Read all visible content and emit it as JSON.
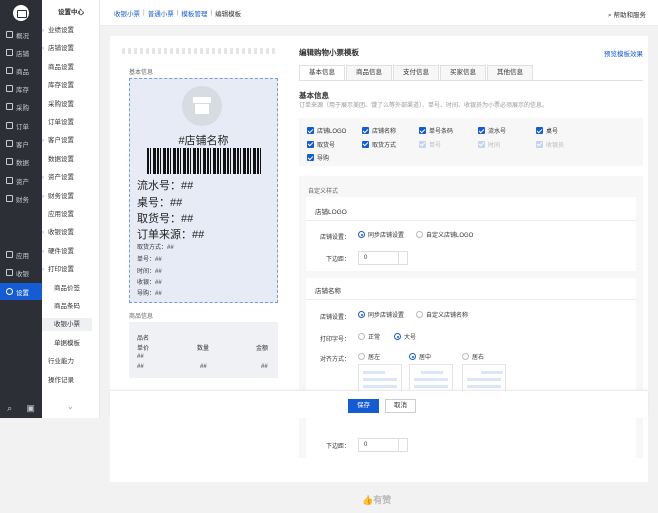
{
  "nav": {
    "items": [
      {
        "label": "概况",
        "icon": "overview-icon"
      },
      {
        "label": "店铺",
        "icon": "store-icon"
      },
      {
        "label": "商品",
        "icon": "goods-icon"
      },
      {
        "label": "库存",
        "icon": "inventory-icon"
      },
      {
        "label": "采购",
        "icon": "purchase-icon"
      },
      {
        "label": "订单",
        "icon": "order-icon"
      },
      {
        "label": "客户",
        "icon": "customer-icon"
      },
      {
        "label": "数据",
        "icon": "data-icon"
      },
      {
        "label": "资产",
        "icon": "asset-icon"
      },
      {
        "label": "财务",
        "icon": "finance-icon"
      }
    ],
    "bottom_items": [
      {
        "label": "应用",
        "icon": "apps-icon"
      },
      {
        "label": "收银",
        "icon": "cashier-icon"
      },
      {
        "label": "设置",
        "icon": "settings-icon"
      }
    ]
  },
  "subnav": {
    "title": "设置中心",
    "items": [
      {
        "label": "业绩设置",
        "type": "group"
      },
      {
        "label": "店铺设置",
        "type": "group"
      },
      {
        "label": "商品设置",
        "type": "item"
      },
      {
        "label": "库存设置",
        "type": "item"
      },
      {
        "label": "采购设置",
        "type": "item"
      },
      {
        "label": "订单设置",
        "type": "item"
      },
      {
        "label": "客户设置",
        "type": "group"
      },
      {
        "label": "数据设置",
        "type": "item"
      },
      {
        "label": "资产设置",
        "type": "group"
      },
      {
        "label": "财务设置",
        "type": "group"
      },
      {
        "label": "应用设置",
        "type": "item"
      },
      {
        "label": "收银设置",
        "type": "group"
      },
      {
        "label": "硬件设置",
        "type": "group"
      },
      {
        "label": "打印设置",
        "type": "open"
      },
      {
        "label": "商品价签",
        "type": "child"
      },
      {
        "label": "商品条码",
        "type": "child"
      },
      {
        "label": "收银小票",
        "type": "child"
      },
      {
        "label": "单据模板",
        "type": "child"
      },
      {
        "label": "行业能力",
        "type": "item"
      },
      {
        "label": "操作记录",
        "type": "item"
      }
    ],
    "selected": "收银小票"
  },
  "breadcrumb": [
    "收银小票",
    "普通小票",
    "模板管理",
    "编辑模板"
  ],
  "help": "帮助和服务",
  "preview": {
    "basic_label": "基本信息",
    "shop_name": "#店铺名称",
    "big_lines": [
      "流水号：##",
      "桌号：##",
      "取货号：##",
      "订单来源：##"
    ],
    "small_lines": [
      "取货方式：##",
      "单号：##",
      "时间：##",
      "收银：##",
      "导购：##"
    ],
    "goods_label": "商品信息",
    "goods": {
      "name_header": "品名",
      "headers": [
        "单价",
        "数量",
        "金额"
      ],
      "row1": "##",
      "row2": [
        "##",
        "##",
        "##"
      ]
    }
  },
  "editor": {
    "title": "编辑购物小票模板",
    "preview_link": "预览模板效果",
    "tabs": [
      "基本信息",
      "商品信息",
      "支付信息",
      "买家信息",
      "其他信息"
    ],
    "active_tab": "基本信息",
    "basic_heading": "基本信息",
    "basic_desc": "订单来源（用于展示美团、饿了么等外部渠道）、单号、时间、收银员为小票必须展示的信息。",
    "checkboxes": [
      {
        "label": "店铺LOGO",
        "checked": true,
        "disabled": false
      },
      {
        "label": "店铺名称",
        "checked": true,
        "disabled": false
      },
      {
        "label": "单号条码",
        "checked": true,
        "disabled": false
      },
      {
        "label": "流水号",
        "checked": true,
        "disabled": false
      },
      {
        "label": "桌号",
        "checked": true,
        "disabled": false
      },
      {
        "label": "取货号",
        "checked": true,
        "disabled": false
      },
      {
        "label": "取货方式",
        "checked": true,
        "disabled": false
      },
      {
        "label": "单号",
        "checked": true,
        "disabled": true
      },
      {
        "label": "时间",
        "checked": true,
        "disabled": true
      },
      {
        "label": "收银员",
        "checked": true,
        "disabled": true
      },
      {
        "label": "导购",
        "checked": true,
        "disabled": false
      }
    ],
    "custom_heading": "自定义样式",
    "logo_card": {
      "title": "店铺LOGO",
      "setting_label": "店铺设置：",
      "options": [
        "同步店铺设置",
        "自定义店铺LOGO"
      ],
      "selected": "同步店铺设置",
      "margin_label": "下边距：",
      "margin_value": "0"
    },
    "name_card": {
      "title": "店铺名称",
      "setting_label": "店铺设置：",
      "options": [
        "同步店铺设置",
        "自定义店铺名称"
      ],
      "selected": "同步店铺设置",
      "size_label": "打印字号：",
      "size_options": [
        "正常",
        "大号"
      ],
      "size_selected": "大号",
      "align_label": "对齐方式：",
      "align_options": [
        "居左",
        "居中",
        "居右"
      ],
      "align_selected": "居中",
      "margin_label": "下边距：",
      "margin_value": "0"
    }
  },
  "footer": {
    "save": "保存",
    "cancel": "取消"
  },
  "brand": "有赞",
  "colors": {
    "accent": "#155bd4",
    "sidebar": "#2c2f35"
  }
}
